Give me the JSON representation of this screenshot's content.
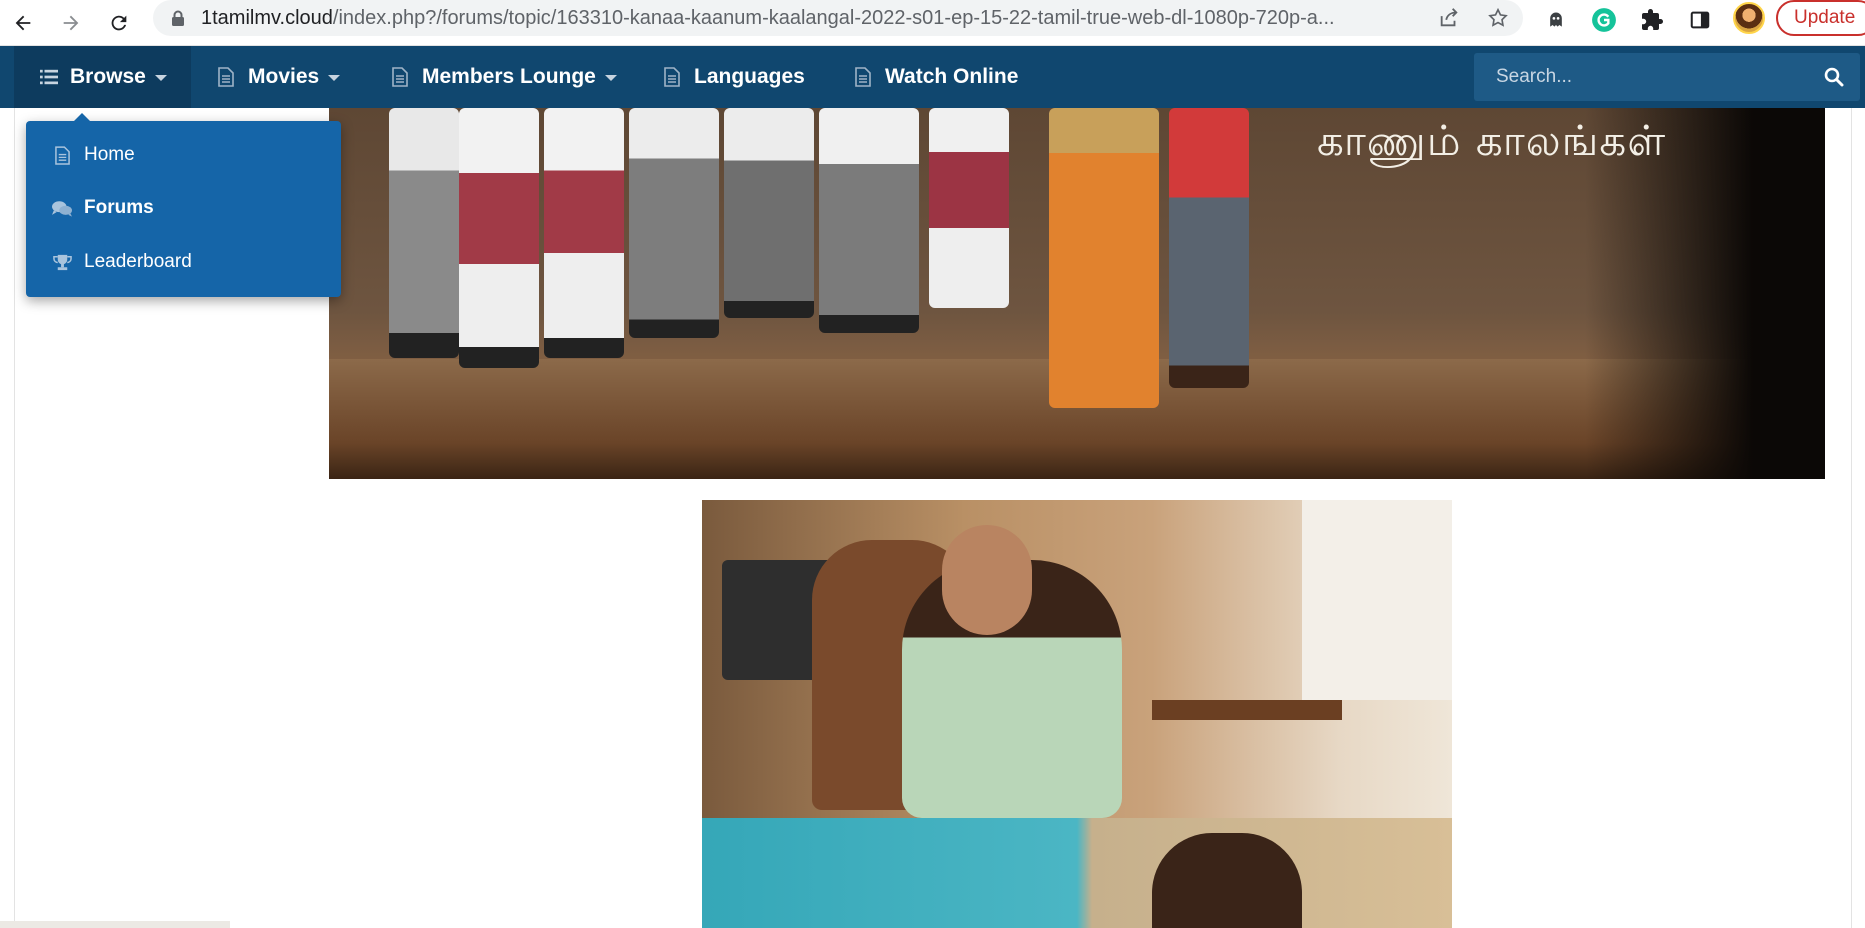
{
  "browser": {
    "url_host": "1tamilmv.cloud",
    "url_path": "/index.php?/forums/topic/163310-kanaa-kaanum-kaalangal-2022-s01-ep-15-22-tamil-true-web-dl-1080p-720p-a...",
    "update_label": "Update",
    "extensions": [
      "ghost-extension-icon",
      "grammarly-icon",
      "puzzle-extensions-icon",
      "side-panel-icon"
    ]
  },
  "navbar": {
    "items": [
      {
        "label": "Browse",
        "icon": "list-icon",
        "has_caret": true,
        "active": true
      },
      {
        "label": "Movies",
        "icon": "document-icon",
        "has_caret": true
      },
      {
        "label": "Members Lounge",
        "icon": "document-icon",
        "has_caret": true
      },
      {
        "label": "Languages",
        "icon": "document-icon",
        "has_caret": false
      },
      {
        "label": "Watch Online",
        "icon": "document-icon",
        "has_caret": false
      }
    ],
    "search_placeholder": "Search..."
  },
  "dropdown": {
    "items": [
      {
        "label": "Home",
        "icon": "document-icon"
      },
      {
        "label": "Forums",
        "icon": "chat-bubbles-icon"
      },
      {
        "label": "Leaderboard",
        "icon": "trophy-icon"
      }
    ]
  },
  "content": {
    "poster_title_text": "காணும் காலங்கள்"
  },
  "colors": {
    "navbar": "#10476f",
    "dropdown": "#1565a8",
    "update_red": "#c9302c"
  }
}
